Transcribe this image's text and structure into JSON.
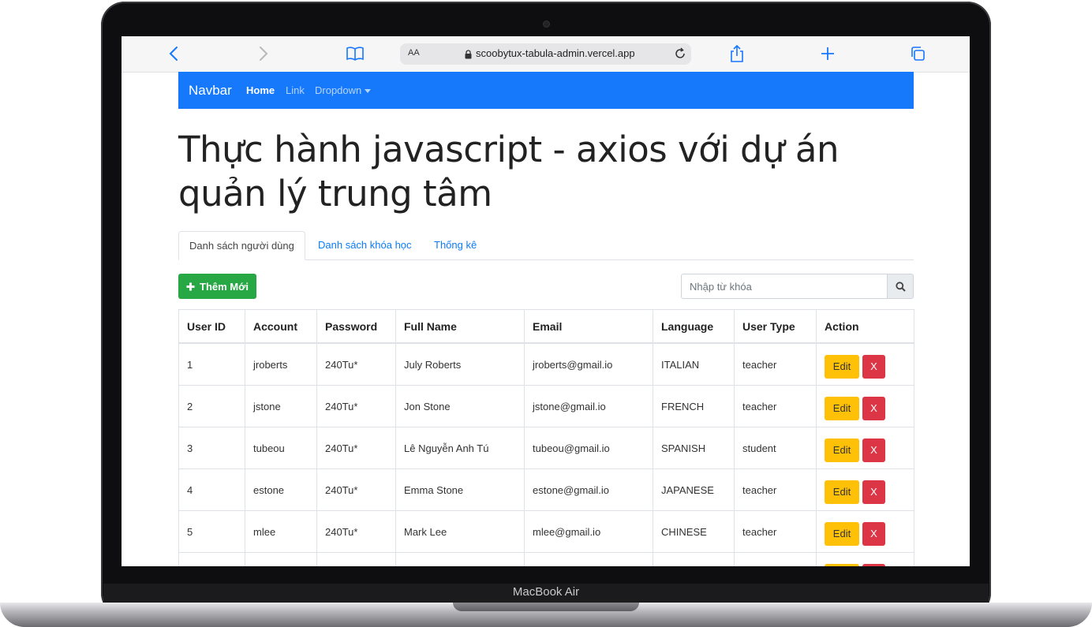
{
  "device": {
    "model": "MacBook Air"
  },
  "browser": {
    "text_size_label": "AA",
    "url": "scoobytux-tabula-admin.vercel.app"
  },
  "navbar": {
    "brand": "Navbar",
    "items": [
      {
        "label": "Home"
      },
      {
        "label": "Link"
      },
      {
        "label": "Dropdown"
      }
    ]
  },
  "page": {
    "title": "Thực hành javascript - axios với dự án quản lý trung tâm"
  },
  "tabs": [
    {
      "label": "Danh sách người dùng",
      "active": true
    },
    {
      "label": "Danh sách khóa học",
      "active": false
    },
    {
      "label": "Thống kê",
      "active": false
    }
  ],
  "actions": {
    "add_label": "Thêm Mới",
    "search_placeholder": "Nhập từ khóa"
  },
  "table": {
    "headers": [
      "User ID",
      "Account",
      "Password",
      "Full Name",
      "Email",
      "Language",
      "User Type",
      "Action"
    ],
    "edit_label": "Edit",
    "delete_label": "X",
    "rows": [
      {
        "id": "1",
        "account": "jroberts",
        "password": "240Tu*",
        "full_name": "July Roberts",
        "email": "jroberts@gmail.io",
        "language": "ITALIAN",
        "user_type": "teacher"
      },
      {
        "id": "2",
        "account": "jstone",
        "password": "240Tu*",
        "full_name": "Jon Stone",
        "email": "jstone@gmail.io",
        "language": "FRENCH",
        "user_type": "teacher"
      },
      {
        "id": "3",
        "account": "tubeou",
        "password": "240Tu*",
        "full_name": "Lê Nguyễn Anh Tú",
        "email": "tubeou@gmail.io",
        "language": "SPANISH",
        "user_type": "student"
      },
      {
        "id": "4",
        "account": "estone",
        "password": "240Tu*",
        "full_name": "Emma Stone",
        "email": "estone@gmail.io",
        "language": "JAPANESE",
        "user_type": "teacher"
      },
      {
        "id": "5",
        "account": "mlee",
        "password": "240Tu*",
        "full_name": "Mark Lee",
        "email": "mlee@gmail.io",
        "language": "CHINESE",
        "user_type": "teacher"
      }
    ]
  },
  "colors": {
    "navbar": "#1679fb",
    "add_button": "#28a745",
    "edit_button": "#ffc107",
    "delete_button": "#dc3545",
    "link": "#0b7bfa"
  },
  "icons": [
    "chevron-left-icon",
    "chevron-right-icon",
    "book-icon",
    "lock-icon",
    "reload-icon",
    "share-icon",
    "plus-icon",
    "tabs-icon",
    "search-icon"
  ]
}
